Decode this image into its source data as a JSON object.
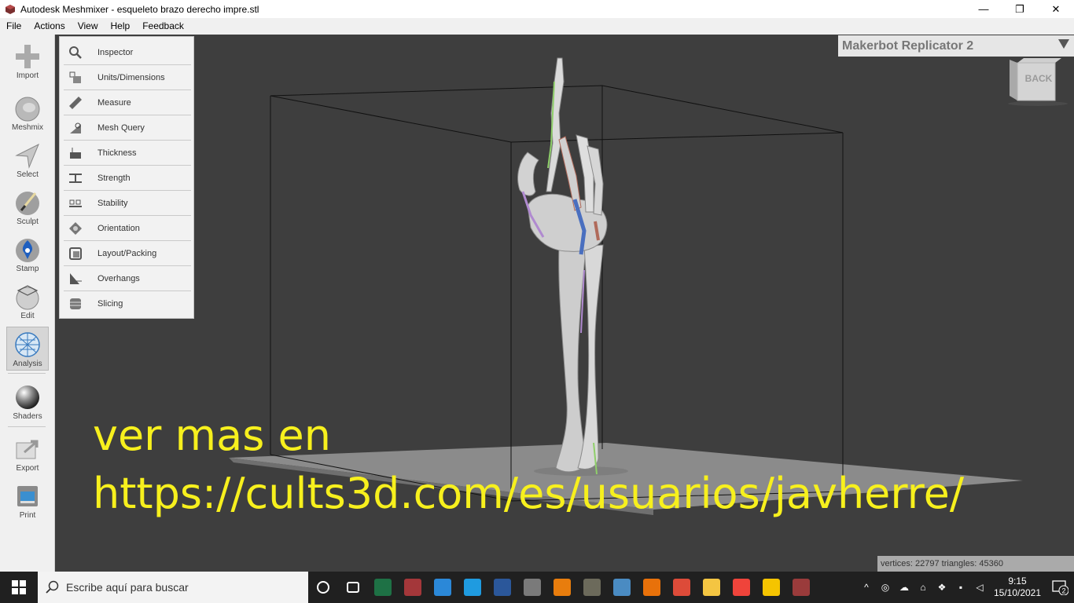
{
  "window": {
    "title": "Autodesk Meshmixer - esqueleto brazo derecho impre.stl",
    "minimize": "—",
    "restore": "❐",
    "close": "✕"
  },
  "menubar": [
    "File",
    "Actions",
    "View",
    "Help",
    "Feedback"
  ],
  "toolbar": [
    {
      "label": "Import",
      "icon": "import-plus-icon"
    },
    {
      "label": "Meshmix",
      "icon": "meshmix-bunny-icon"
    },
    {
      "label": "Select",
      "icon": "select-arrow-icon"
    },
    {
      "label": "Sculpt",
      "icon": "sculpt-brush-icon"
    },
    {
      "label": "Stamp",
      "icon": "stamp-icon"
    },
    {
      "label": "Edit",
      "icon": "edit-sphere-icon"
    },
    {
      "label": "Analysis",
      "icon": "analysis-sphere-icon",
      "active": true
    },
    {
      "label": "Shaders",
      "icon": "shaders-sphere-icon"
    },
    {
      "label": "Export",
      "icon": "export-icon"
    },
    {
      "label": "Print",
      "icon": "print-icon"
    }
  ],
  "analysis_menu": [
    {
      "label": "Inspector",
      "icon": "magnifier-icon"
    },
    {
      "label": "Units/Dimensions",
      "icon": "units-dimensions-icon"
    },
    {
      "label": "Measure",
      "icon": "ruler-icon"
    },
    {
      "label": "Mesh Query",
      "icon": "mesh-query-icon"
    },
    {
      "label": "Thickness",
      "icon": "thickness-icon"
    },
    {
      "label": "Strength",
      "icon": "strength-icon"
    },
    {
      "label": "Stability",
      "icon": "stability-icon"
    },
    {
      "label": "Orientation",
      "icon": "orientation-icon"
    },
    {
      "label": "Layout/Packing",
      "icon": "layout-packing-icon"
    },
    {
      "label": "Overhangs",
      "icon": "overhangs-icon"
    },
    {
      "label": "Slicing",
      "icon": "slicing-icon"
    }
  ],
  "printer": {
    "name": "Makerbot Replicator 2"
  },
  "viewcube": {
    "face": "BACK"
  },
  "overlay": {
    "line1": "ver mas en",
    "line2": "https://cults3d.com/es/usuarios/javherre/"
  },
  "stats": {
    "text": "vertices: 22797 triangles: 45360"
  },
  "taskbar": {
    "search_placeholder": "Escribe aquí para buscar",
    "apps": [
      {
        "name": "cortana-icon",
        "color": "#ffffff"
      },
      {
        "name": "task-view-icon",
        "color": "#ffffff"
      },
      {
        "name": "excel-icon",
        "color": "#1e7145"
      },
      {
        "name": "access-icon",
        "color": "#a4373a"
      },
      {
        "name": "s-app-icon",
        "color": "#2b88d8"
      },
      {
        "name": "edge-icon",
        "color": "#1f9be0"
      },
      {
        "name": "word-icon",
        "color": "#2b579a"
      },
      {
        "name": "calculator-icon",
        "color": "#7a7a7a"
      },
      {
        "name": "blender-icon",
        "color": "#e87d0d"
      },
      {
        "name": "gimp-icon",
        "color": "#6c6a5b"
      },
      {
        "name": "network-app-icon",
        "color": "#4a8bc2"
      },
      {
        "name": "3d-box-icon",
        "color": "#e8710a"
      },
      {
        "name": "chrome-icon",
        "color": "#dd4b39"
      },
      {
        "name": "file-explorer-icon",
        "color": "#f4c542"
      },
      {
        "name": "anydesk-icon",
        "color": "#ef443b"
      },
      {
        "name": "ib-app-icon",
        "color": "#f5c400"
      },
      {
        "name": "meshmixer-icon",
        "color": "#9a3b3b"
      }
    ],
    "time": "9:15",
    "date": "15/10/2021",
    "notifications": "2"
  }
}
